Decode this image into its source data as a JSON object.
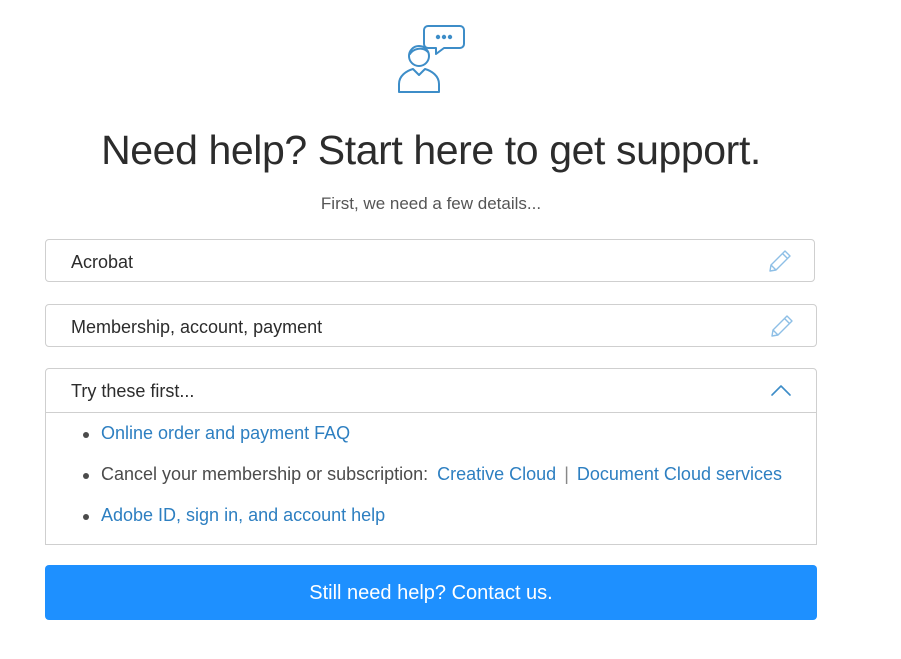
{
  "header": {
    "icon": "support-chat-person-icon",
    "title": "Need help? Start here to get support.",
    "subtitle": "First, we need a few details..."
  },
  "form": {
    "product": {
      "value": "Acrobat",
      "edit_icon": "pencil-icon"
    },
    "issue": {
      "value": "Membership, account, payment",
      "edit_icon": "pencil-icon"
    }
  },
  "tips": {
    "header_label": "Try these first...",
    "toggle_icon": "chevron-up-icon",
    "items": [
      {
        "link": "Online order and payment FAQ"
      },
      {
        "text": "Cancel your membership or subscription:",
        "links": [
          "Creative Cloud",
          "Document Cloud services"
        ],
        "separator": "|"
      },
      {
        "link": "Adobe ID, sign in, and account help"
      }
    ]
  },
  "contact": {
    "label": "Still need help? Contact us."
  },
  "colors": {
    "accent": "#1e90ff",
    "link": "#2d7fc1",
    "icon": "#3d8dc8",
    "border": "#cfcfcf"
  }
}
